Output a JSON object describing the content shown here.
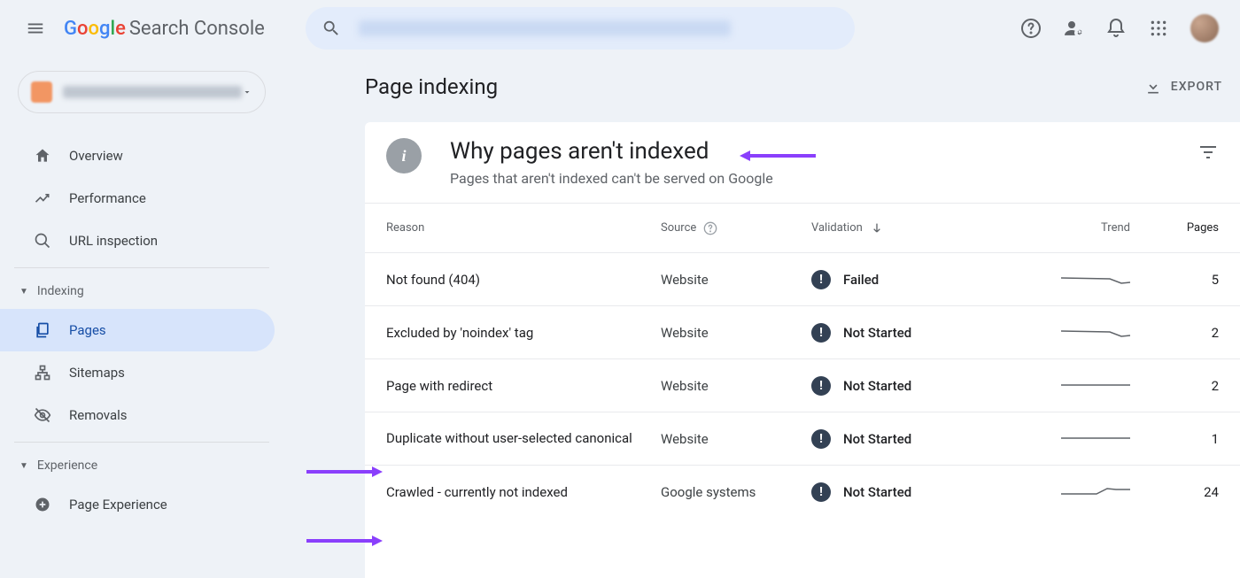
{
  "header": {
    "product_suffix": "Search Console"
  },
  "sidebar": {
    "items": {
      "overview": "Overview",
      "performance": "Performance",
      "url_inspection": "URL inspection",
      "pages": "Pages",
      "sitemaps": "Sitemaps",
      "removals": "Removals",
      "page_experience": "Page Experience"
    },
    "groups": {
      "indexing": "Indexing",
      "experience": "Experience"
    }
  },
  "page": {
    "title": "Page indexing",
    "export": "EXPORT"
  },
  "card": {
    "title": "Why pages aren't indexed",
    "subtitle": "Pages that aren't indexed can't be served on Google"
  },
  "columns": {
    "reason": "Reason",
    "source": "Source",
    "validation": "Validation",
    "trend": "Trend",
    "pages": "Pages"
  },
  "rows": [
    {
      "reason": "Not found (404)",
      "source": "Website",
      "validation": "Failed",
      "pages": "5"
    },
    {
      "reason": "Excluded by 'noindex' tag",
      "source": "Website",
      "validation": "Not Started",
      "pages": "2"
    },
    {
      "reason": "Page with redirect",
      "source": "Website",
      "validation": "Not Started",
      "pages": "2"
    },
    {
      "reason": "Duplicate without user-selected canonical",
      "source": "Website",
      "validation": "Not Started",
      "pages": "1"
    },
    {
      "reason": "Crawled - currently not indexed",
      "source": "Google systems",
      "validation": "Not Started",
      "pages": "24"
    }
  ]
}
